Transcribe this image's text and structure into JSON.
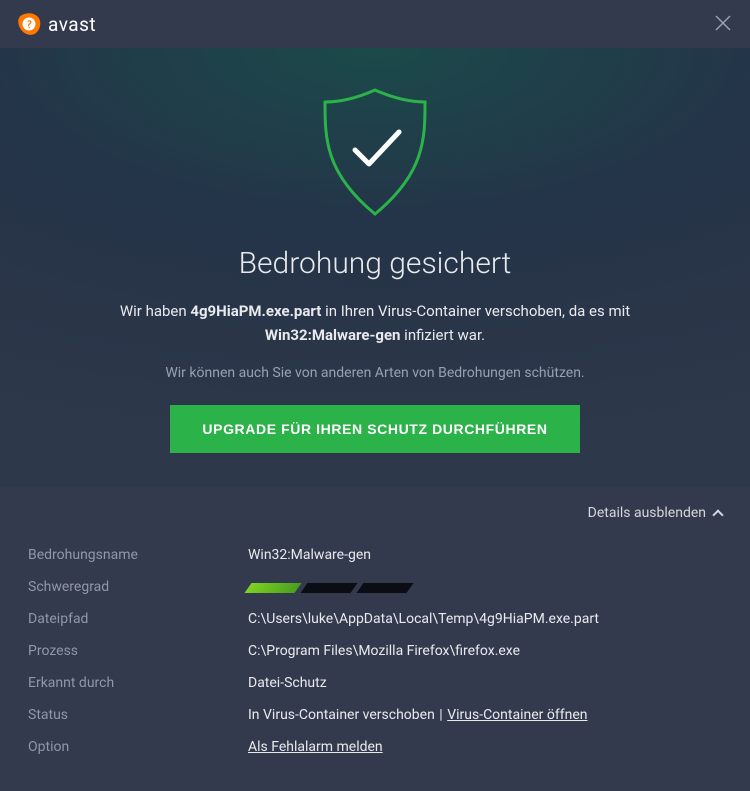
{
  "titlebar": {
    "brand": "avast"
  },
  "hero": {
    "headline": "Bedrohung gesichert",
    "subline_prefix": "Wir haben ",
    "subline_file": "4g9HiaPM.exe.part",
    "subline_mid": " in Ihren Virus-Container verschoben, da es mit ",
    "subline_threat": "Win32:Malware-gen",
    "subline_suffix": " infiziert war.",
    "infoline": "Wir können auch Sie von anderen Arten von Bedrohungen schützen.",
    "upgrade_label": "UPGRADE FÜR IHREN SCHUTZ DURCHFÜHREN"
  },
  "details_toggle": "Details ausblenden",
  "details": {
    "threat_name": {
      "label": "Bedrohungsname",
      "value": "Win32:Malware-gen"
    },
    "severity": {
      "label": "Schweregrad",
      "level": 1,
      "max": 3
    },
    "filepath": {
      "label": "Dateipfad",
      "value": "C:\\Users\\luke\\AppData\\Local\\Temp\\4g9HiaPM.exe.part"
    },
    "process": {
      "label": "Prozess",
      "value": "C:\\Program Files\\Mozilla Firefox\\firefox.exe"
    },
    "detected_by": {
      "label": "Erkannt durch",
      "value": "Datei-Schutz"
    },
    "status": {
      "label": "Status",
      "text": "In Virus-Container verschoben",
      "separator": " | ",
      "link": "Virus-Container öffnen"
    },
    "option": {
      "label": "Option",
      "link": "Als Fehlalarm melden"
    }
  }
}
